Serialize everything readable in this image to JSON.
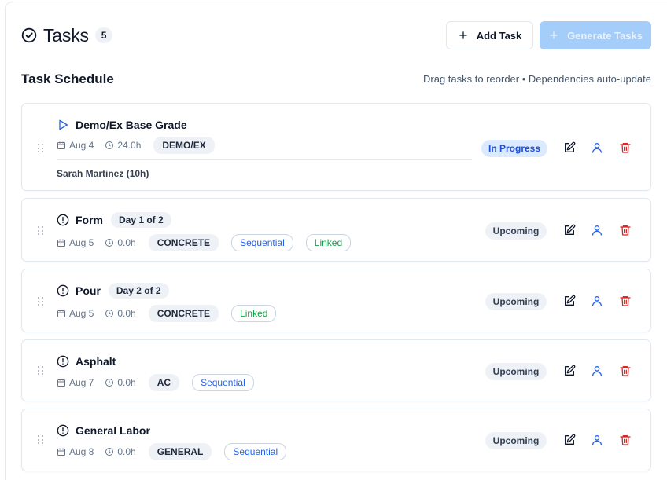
{
  "header": {
    "title": "Tasks",
    "count": "5",
    "add_label": "Add Task",
    "generate_label": "Generate Tasks"
  },
  "schedule": {
    "title": "Task Schedule",
    "hint": "Drag tasks to reorder • Dependencies auto-update"
  },
  "colors": {
    "primary_disabled": "#a5cdf9",
    "in_progress_bg": "#dbeafe",
    "delete": "#dc2626",
    "assign": "#2563eb",
    "linked": "#16a34a"
  },
  "tasks": [
    {
      "name": "Demo/Ex Base Grade",
      "status_icon": "play-icon",
      "date": "Aug 4",
      "hours": "24.0h",
      "category": "DEMO/EX",
      "status": "In Progress",
      "assignee": "Sarah Martinez (10h)"
    },
    {
      "name": "Form",
      "status_icon": "alert-circle-icon",
      "day": "Day 1 of 2",
      "date": "Aug 5",
      "hours": "0.0h",
      "category": "CONCRETE",
      "sequential": "Sequential",
      "linked": "Linked",
      "status": "Upcoming"
    },
    {
      "name": "Pour",
      "status_icon": "alert-circle-icon",
      "day": "Day 2 of 2",
      "date": "Aug 5",
      "hours": "0.0h",
      "category": "CONCRETE",
      "linked": "Linked",
      "status": "Upcoming"
    },
    {
      "name": "Asphalt",
      "status_icon": "alert-circle-icon",
      "date": "Aug 7",
      "hours": "0.0h",
      "category": "AC",
      "sequential": "Sequential",
      "status": "Upcoming"
    },
    {
      "name": "General Labor",
      "status_icon": "alert-circle-icon",
      "date": "Aug 8",
      "hours": "0.0h",
      "category": "GENERAL",
      "sequential": "Sequential",
      "status": "Upcoming"
    }
  ]
}
